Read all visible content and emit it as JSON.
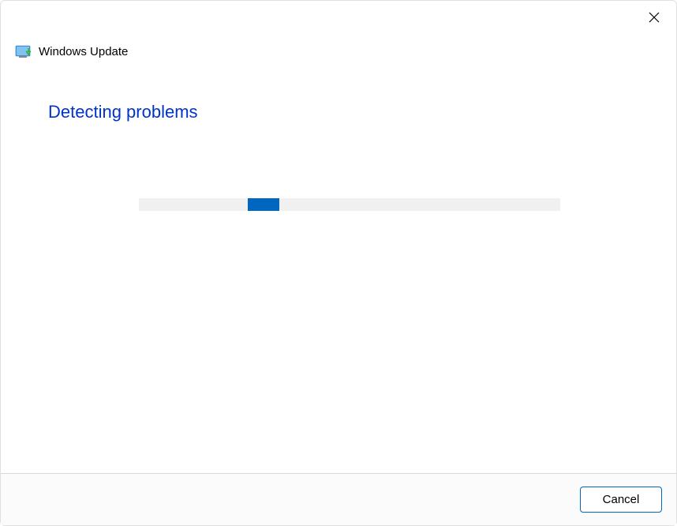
{
  "header": {
    "title": "Windows Update"
  },
  "main": {
    "status_text": "Detecting problems"
  },
  "footer": {
    "cancel_label": "Cancel"
  }
}
